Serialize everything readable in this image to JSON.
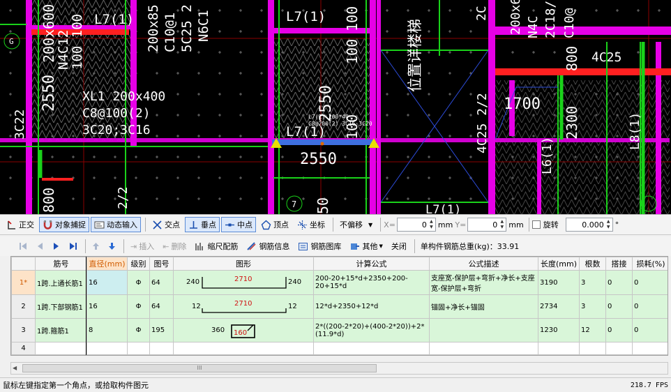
{
  "cad": {
    "labels": {
      "l7a": "L7(1)",
      "l7b": "L7(1)",
      "l7c": "L7(1)",
      "l7d": "L7(1)",
      "xl1": "XL1 200x400",
      "xl1_stirrup": "C8@100(2)",
      "xl1_bars": "3C20;3C16",
      "dim2550a": "2550",
      "dim2550b": "2550",
      "dim2550c": "2550",
      "dim1700": "1700",
      "dim2300": "2300",
      "dim800a": "800",
      "dim800b": "800",
      "dim100": "100",
      "dim200a": "200",
      "dim200b": "200",
      "v200x85": "200x85",
      "vc10": "C10@1",
      "v5c25": "5C25 2",
      "vn6c1": "N6C1",
      "vn4c12": "N4C12",
      "v100100": "100 100",
      "v200600": "200x600",
      "v100b": "100",
      "v100c": "100",
      "v50": "50",
      "stair": "位置详楼梯",
      "v4c25a": "4C25",
      "v4c25b": "4C25 2/2",
      "v3c22": "3C22",
      "v22": "2/2",
      "vl6": "L6(1)",
      "vl8": "L8(1)",
      "vc10b": "C10@",
      "v2c": "2C",
      "vn4c": "N4C",
      "v2c18": "2C18/",
      "vc10c": "C10@",
      "axis_g": "G",
      "axis_7": "7",
      "tiny1": "L7(1) 200*40",
      "tiny2": "C8@200(2) 3C16 3C20"
    }
  },
  "snapbar": {
    "ortho": "正交",
    "object_snap": "对象捕捉",
    "dynamic_input": "动态输入",
    "intersection": "交点",
    "perpendicular": "垂点",
    "midpoint": "中点",
    "vertex": "顶点",
    "coordinate": "坐标",
    "offset_mode": "不偏移",
    "x_label": "X=",
    "x_value": "0",
    "x_unit": "mm",
    "y_label": "Y=",
    "y_value": "0",
    "y_unit": "mm",
    "rotate": "旋转",
    "rotate_value": "0.000",
    "degree": "°"
  },
  "gridbar": {
    "insert": "插入",
    "delete": "删除",
    "scale_rebar": "缩尺配筋",
    "rebar_info": "钢筋信息",
    "rebar_library": "钢筋图库",
    "other": "其他",
    "close": "关闭",
    "total_weight": "单构件钢筋总重(kg)：33.91"
  },
  "table": {
    "headers": [
      "",
      "筋号",
      "直径(mm)",
      "级别",
      "图号",
      "图形",
      "计算公式",
      "公式描述",
      "长度(mm)",
      "根数",
      "搭接",
      "损耗(%)"
    ],
    "rows": [
      {
        "idx": "1*",
        "name": "1跨.上通长筋1",
        "dia": "16",
        "grade": "Φ",
        "fig": "64",
        "shape": {
          "left": "240",
          "mid": "2710",
          "right": "240"
        },
        "formula": "200-20+15*d+2350+200-20+15*d",
        "desc": "支座宽-保护层+弯折+净长+支座宽-保护层+弯折",
        "length": "3190",
        "count": "3",
        "lap": "0",
        "loss": "0"
      },
      {
        "idx": "2",
        "name": "1跨.下部钢筋1",
        "dia": "16",
        "grade": "Φ",
        "fig": "64",
        "shape": {
          "left": "12",
          "mid": "2710",
          "right": "12"
        },
        "formula": "12*d+2350+12*d",
        "desc": "锚固+净长+锚固",
        "length": "2734",
        "count": "3",
        "lap": "0",
        "loss": "0"
      },
      {
        "idx": "3",
        "name": "1跨.箍筋1",
        "dia": "8",
        "grade": "Φ",
        "fig": "195",
        "shape": {
          "left": "360",
          "mid": "160",
          "right": ""
        },
        "formula": "2*((200-2*20)+(400-2*20))+2*(11.9*d)",
        "desc": "",
        "length": "1230",
        "count": "12",
        "lap": "0",
        "loss": "0"
      },
      {
        "idx": "4",
        "name": "",
        "dia": "",
        "grade": "",
        "fig": "",
        "shape": {
          "left": "",
          "mid": "",
          "right": ""
        },
        "formula": "",
        "desc": "",
        "length": "",
        "count": "",
        "lap": "",
        "loss": ""
      }
    ]
  },
  "scrollbar": {
    "grip": "III"
  },
  "status": {
    "message": "鼠标左键指定第一个角点，或拾取构件图元",
    "fps": "218.7 FPS"
  },
  "colors": {
    "magenta": "#e600e6",
    "green": "#1ad21a",
    "red": "#ff2020",
    "row_bg": "#d9f6d9",
    "selected_header": "#d05b00"
  }
}
